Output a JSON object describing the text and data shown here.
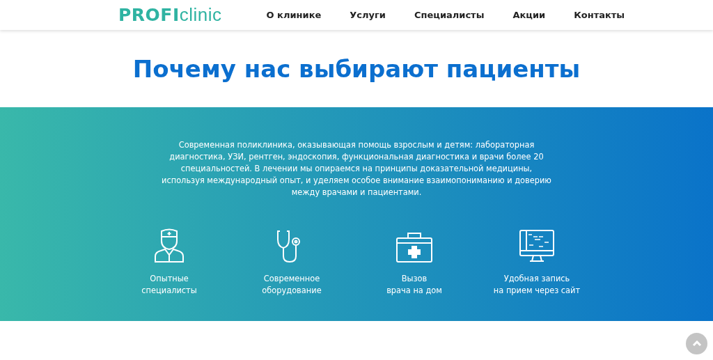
{
  "header": {
    "logo": {
      "bold": "PROFI",
      "light": "clinic"
    },
    "nav": [
      {
        "label": "О клинике"
      },
      {
        "label": "Услуги"
      },
      {
        "label": "Специалисты"
      },
      {
        "label": "Акции"
      },
      {
        "label": "Контакты"
      }
    ]
  },
  "title": "Почему нас выбирают пациенты",
  "intro": "Современная поликлиника, оказывающая помощь взрослым и детям: лабораторная диагностика, УЗИ, рентген, эндоскопия, функциональная диагностика и врачи более 20 специальностей. В лечении мы опираемся на принципы доказательной медицины, используя международный опыт, и уделяем особое внимание взаимопониманию и доверию между врачами и пациентами.",
  "features": [
    {
      "kind": "doctor",
      "lines": [
        "Опытные",
        "специалисты"
      ]
    },
    {
      "kind": "stethoscope",
      "lines": [
        "Современное",
        "оборудование"
      ]
    },
    {
      "kind": "medkit",
      "lines": [
        "Вызов",
        "врача на дом"
      ]
    },
    {
      "kind": "monitor",
      "lines": [
        "Удобная запись",
        "на прием через сайт"
      ]
    }
  ]
}
